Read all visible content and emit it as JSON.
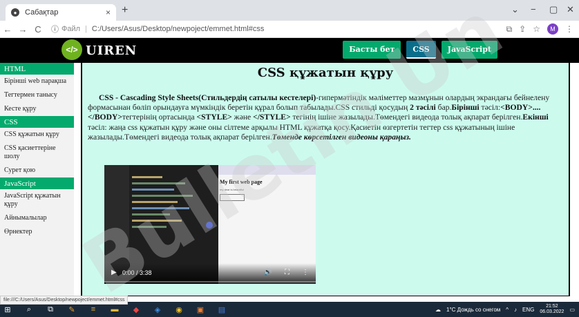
{
  "browser": {
    "tab_title": "Сабақтар",
    "tab_close": "×",
    "new_tab": "+",
    "window_controls": [
      "⌄",
      "−",
      "▢",
      "✕"
    ],
    "nav": {
      "back": "←",
      "forward": "→",
      "reload": "C"
    },
    "url_scheme": "Файл",
    "url_path": "C:/Users/Asus/Desktop/newpoject/emmet.html#css",
    "profile_initial": "M"
  },
  "site": {
    "logo_icon": "</>",
    "logo_text": "UIREN",
    "nav": [
      "Басты бет",
      "CSS",
      "JavaScript"
    ]
  },
  "sidebar": {
    "html_head": "HTML",
    "html_items": [
      "Бірінші web парақша",
      "Тегтермен танысу",
      "Кесте құру"
    ],
    "css_head": "CSS",
    "css_items": [
      "CSS құжатын құру",
      "CSS қасиеттеріне шолу",
      "Сурет қою"
    ],
    "js_head": "JavaScript",
    "js_items": [
      "JavaScript құжатын құру",
      "Айнымалылар",
      "Өрнектер"
    ]
  },
  "main": {
    "title": "CSS құжатын құру",
    "p1_bold": "CSS - Cascading Style Sheets(Стильдердің сатылы кестелері)",
    "p1_text": "-гипермәтіндік мәліметтер мазмұнын олардың экрандағы бейнелену формасынан бөліп орындауға мүмкіндік беретін құрал болып табылады.CSS стильді қосудың ",
    "p1_bold2": "2 тәсілі",
    "p1_text2": " бар.",
    "p1_bold3": "Бірінші",
    "p1_text3": " тәсіл:",
    "p1_code1": "<BODY>....</BODY>",
    "p1_text4": "тегтерінің ортасында ",
    "p1_code2": "<STYLE>",
    "p1_text5": " және ",
    "p1_code3": "</STYLE>",
    "p1_text6": " тегінің ішіне жазылады.Төмендегі видеода толық ақпарат берілген.",
    "p1_bold4": "Екінші",
    "p1_text7": " тәсіл: жаңа css құжатын құру және оны сілтеме арқылы HTML құжатқа қосу.Қасиетін өзгертетін тегтер css құжатының ішіне жазылады.Төмендегі видеода толық ақпарат берілген.",
    "p1_italic": "Төменде көрсетілген видеоны қараңыз."
  },
  "video": {
    "page_title": "My first web page",
    "page_sub": "my dear is beautiful",
    "play_icon": "▶",
    "time": "0:00 / 3:38",
    "volume_icon": "🔊",
    "fullscreen_icon": "⛶",
    "menu_icon": "⋮"
  },
  "status_url": "file:///C:/Users/Asus/Desktop/newpoject/emmet.html#css",
  "watermark": "Bulletin Un",
  "taskbar": {
    "weather": "1°C  Дождь со снегом",
    "lang": "ENG",
    "time": "21:52",
    "date": "06.03.2022"
  }
}
